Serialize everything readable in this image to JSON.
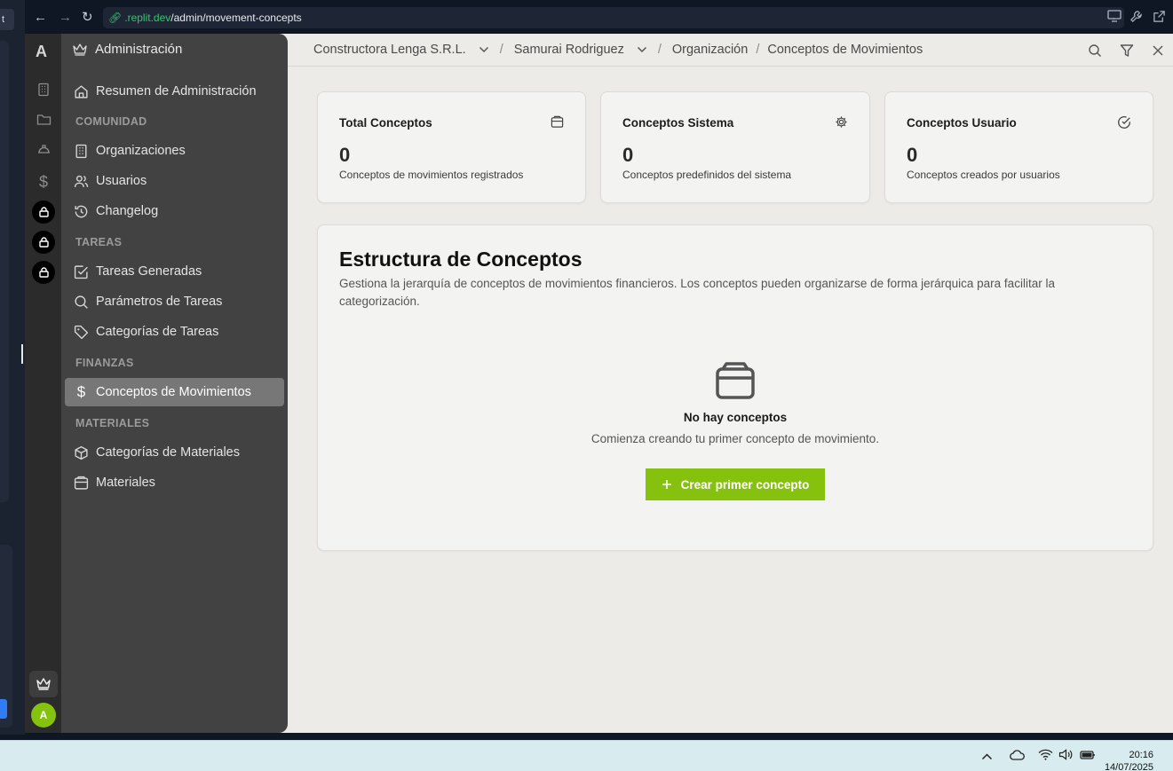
{
  "browser": {
    "url_domain": ".replit.dev",
    "url_path": "/admin/movement-concepts"
  },
  "rail": {
    "logo": "A",
    "avatar_initial": "A",
    "accent": "#84c20f"
  },
  "sidebar": {
    "header": "Administración",
    "items": [
      {
        "label": "Resumen de Administración",
        "icon": "home-icon"
      },
      {
        "section": "COMUNIDAD"
      },
      {
        "label": "Organizaciones",
        "icon": "building-icon"
      },
      {
        "label": "Usuarios",
        "icon": "users-icon"
      },
      {
        "label": "Changelog",
        "icon": "history-icon"
      },
      {
        "section": "TAREAS"
      },
      {
        "label": "Tareas Generadas",
        "icon": "check-square-icon"
      },
      {
        "label": "Parámetros de Tareas",
        "icon": "search-icon"
      },
      {
        "label": "Categorías de Tareas",
        "icon": "tag-icon"
      },
      {
        "section": "FINANZAS"
      },
      {
        "label": "Conceptos de Movimientos",
        "icon": "dollar-icon",
        "active": true
      },
      {
        "section": "MATERIALES"
      },
      {
        "label": "Categorías de Materiales",
        "icon": "cube-icon"
      },
      {
        "label": "Materiales",
        "icon": "package-icon"
      }
    ]
  },
  "breadcrumb": {
    "company": "Constructora Lenga S.R.L.",
    "user": "Samurai Rodriguez",
    "section": "Organización",
    "page": "Conceptos de Movimientos"
  },
  "stats": [
    {
      "title": "Total Conceptos",
      "value": "0",
      "desc": "Conceptos de movimientos registrados",
      "icon": "package-icon"
    },
    {
      "title": "Conceptos Sistema",
      "value": "0",
      "desc": "Conceptos predefinidos del sistema",
      "icon": "gear-icon"
    },
    {
      "title": "Conceptos Usuario",
      "value": "0",
      "desc": "Conceptos creados por usuarios",
      "icon": "check-circle-icon"
    }
  ],
  "structure": {
    "title": "Estructura de Conceptos",
    "description": "Gestiona la jerarquía de conceptos de movimientos financieros. Los conceptos pueden organizarse de forma jerárquica para facilitar la categorización.",
    "empty_title": "No hay conceptos",
    "empty_desc": "Comienza creando tu primer concepto de movimiento.",
    "cta_label": "Crear primer concepto"
  },
  "taskbar": {
    "time": "20:16",
    "date": "14/07/2025"
  }
}
